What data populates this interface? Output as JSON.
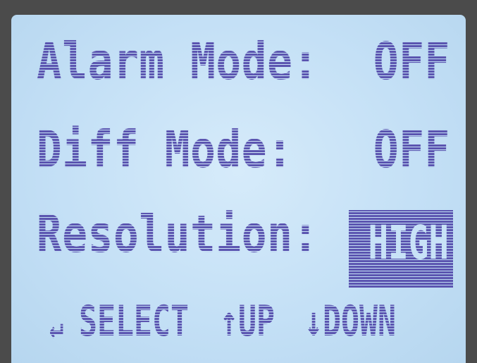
{
  "menu": {
    "rows": [
      {
        "label": "Alarm Mode:",
        "value": "OFF"
      },
      {
        "label": "Diff Mode:",
        "value": "OFF"
      },
      {
        "label": "Resolution:",
        "value": "HIGH"
      }
    ]
  },
  "footer": {
    "enter_icon": "↵",
    "select_label": "SELECT",
    "up_icon": "↑",
    "up_label": "UP",
    "down_icon": "↓",
    "down_label": "DOWN"
  },
  "colors": {
    "lcd_background": "#c4e0f6",
    "pixel_color": "#5b55b0",
    "bezel": "#4b4b4b"
  }
}
